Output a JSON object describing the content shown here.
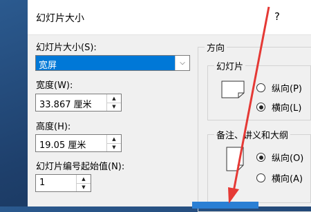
{
  "dialog": {
    "title": "幻灯片大小",
    "help": "?"
  },
  "size": {
    "label": "幻灯片大小(S):",
    "selected": "宽屏"
  },
  "width": {
    "label": "宽度(W):",
    "value": "33.867 厘米"
  },
  "height": {
    "label": "高度(H):",
    "value": "19.05 厘米"
  },
  "numbering": {
    "label": "幻灯片编号起始值(N):",
    "value": "1"
  },
  "orientation": {
    "label": "方向",
    "slides": {
      "label": "幻灯片",
      "portrait": "纵向(P)",
      "landscape": "横向(L)",
      "selected": "landscape"
    },
    "notes": {
      "label": "备注、讲义和大纲",
      "portrait": "纵向(O)",
      "landscape": "横向(A)",
      "selected": "portrait"
    }
  },
  "colors": {
    "annotation_arrow": "#e53935",
    "selection": "#0078d7"
  }
}
